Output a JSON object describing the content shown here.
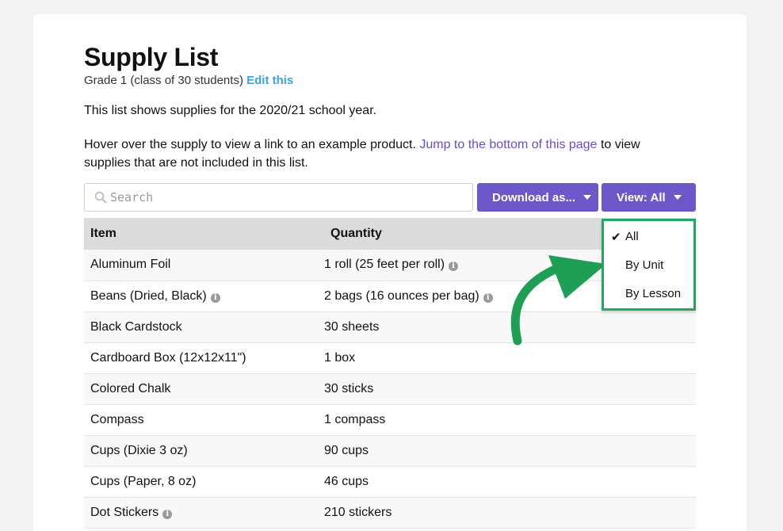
{
  "page": {
    "title": "Supply List",
    "subtitle": "Grade 1 (class of 30 students)",
    "edit_link": "Edit this",
    "paragraph1": "This list shows supplies for the 2020/21 school year.",
    "paragraph2_pre": "Hover over the supply to view a link to an example product.",
    "paragraph2_link": "Jump to the bottom of this page",
    "paragraph2_post": "to view supplies that are not included in this list."
  },
  "toolbar": {
    "search_placeholder": "Search",
    "download_label": "Download as...",
    "view_label": "View: All"
  },
  "view_menu": {
    "items": [
      {
        "label": "All",
        "checked": true
      },
      {
        "label": "By Unit",
        "checked": false
      },
      {
        "label": "By Lesson",
        "checked": false
      }
    ]
  },
  "table": {
    "headers": [
      "Item",
      "Quantity"
    ],
    "rows": [
      {
        "item": "Aluminum Foil",
        "item_info": false,
        "quantity": "1 roll (25 feet per roll)",
        "qty_info": true
      },
      {
        "item": "Beans (Dried, Black)",
        "item_info": true,
        "quantity": "2 bags (16 ounces per bag)",
        "qty_info": true
      },
      {
        "item": "Black Cardstock",
        "item_info": false,
        "quantity": "30 sheets",
        "qty_info": false
      },
      {
        "item": "Cardboard Box (12x12x11\")",
        "item_info": false,
        "quantity": "1 box",
        "qty_info": false
      },
      {
        "item": "Colored Chalk",
        "item_info": false,
        "quantity": "30 sticks",
        "qty_info": false
      },
      {
        "item": "Compass",
        "item_info": false,
        "quantity": "1 compass",
        "qty_info": false
      },
      {
        "item": "Cups (Dixie 3 oz)",
        "item_info": false,
        "quantity": "90 cups",
        "qty_info": false
      },
      {
        "item": "Cups (Paper, 8 oz)",
        "item_info": false,
        "quantity": "46 cups",
        "qty_info": false
      },
      {
        "item": "Dot Stickers",
        "item_info": true,
        "quantity": "210 stickers",
        "qty_info": false
      }
    ]
  },
  "colors": {
    "accent": "#6e57c9",
    "link_blue": "#3aa3e3",
    "link_purple": "#6a4fc8",
    "highlight_green": "#24a660"
  }
}
